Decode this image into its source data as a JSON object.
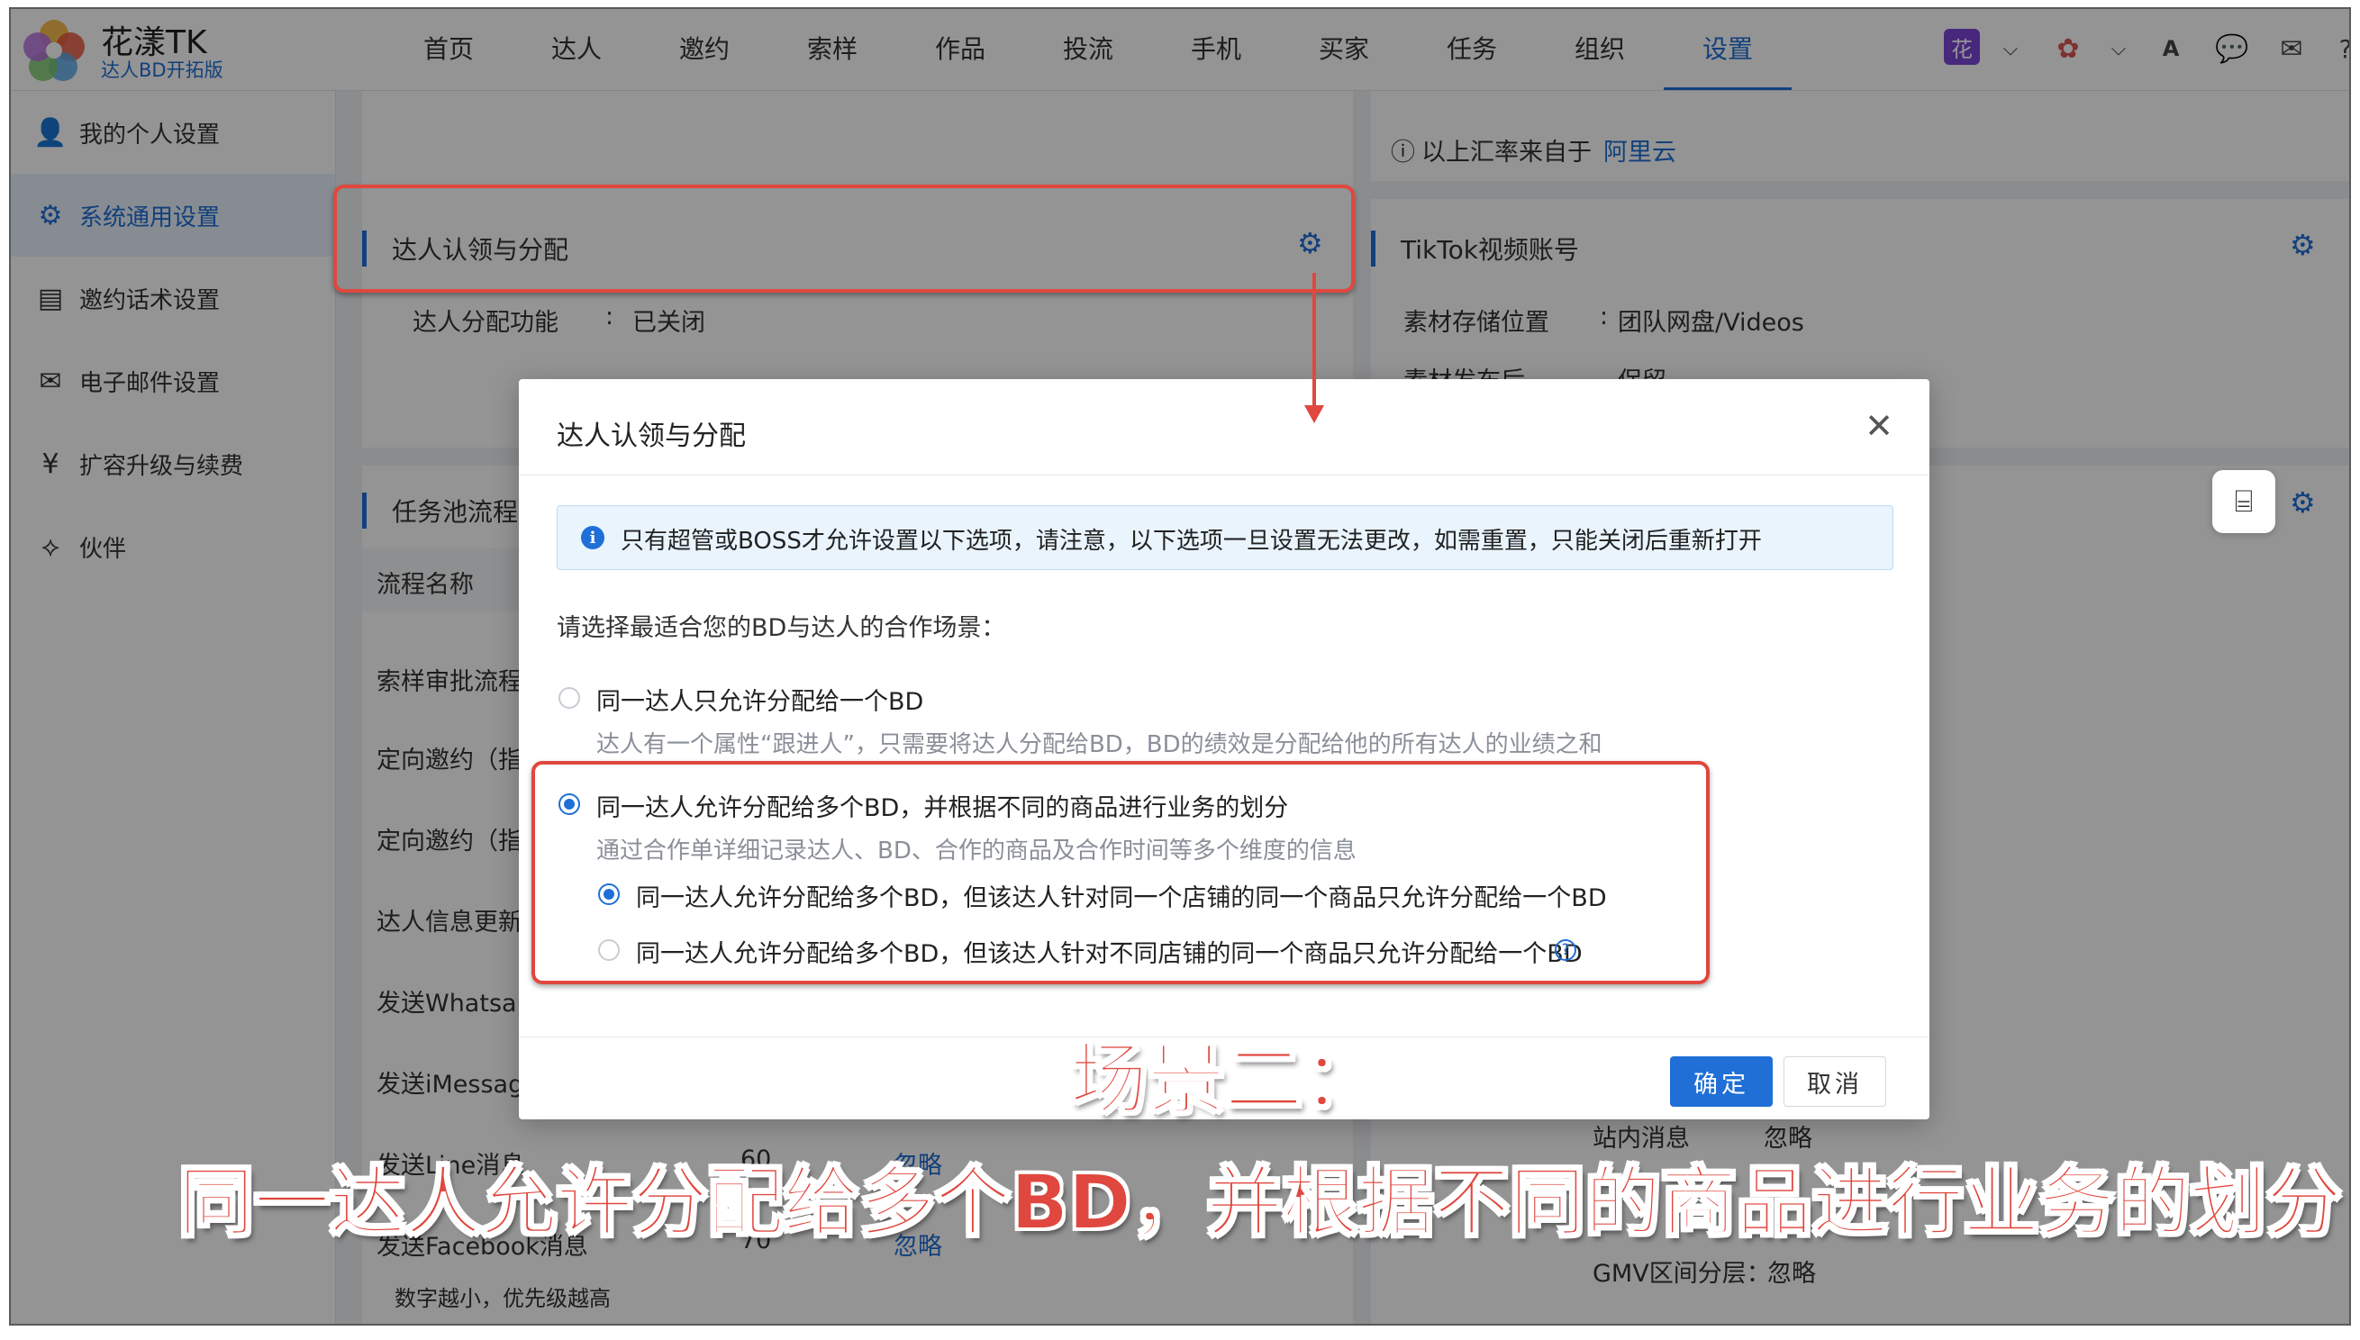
{
  "header": {
    "brand_name": "花漾TK",
    "brand_sub": "达人BD开拓版",
    "nav": [
      "首页",
      "达人",
      "邀约",
      "索样",
      "作品",
      "投流",
      "手机",
      "买家",
      "任务",
      "组织",
      "设置"
    ],
    "nav_active": "设置",
    "avatar_text": "花",
    "translate_glyph": "A"
  },
  "sidebar": {
    "items": [
      {
        "label": "我的个人设置",
        "icon": "user-icon",
        "glyph": "👤"
      },
      {
        "label": "系统通用设置",
        "icon": "gear-icon",
        "glyph": "⚙"
      },
      {
        "label": "邀约话术设置",
        "icon": "document-icon",
        "glyph": "▤"
      },
      {
        "label": "电子邮件设置",
        "icon": "mail-icon",
        "glyph": "✉"
      },
      {
        "label": "扩容升级与续费",
        "icon": "yen-icon",
        "glyph": "¥"
      },
      {
        "label": "伙伴",
        "icon": "handshake-icon",
        "glyph": "⟡"
      }
    ]
  },
  "bg": {
    "exchange_note": "以上汇率来自于",
    "exchange_link": "阿里云",
    "claim_card_title": "达人认领与分配",
    "claim_label": "达人分配功能",
    "claim_value": "已关闭",
    "tiktok_title": "TikTok视频账号",
    "storage_label": "素材存储位置",
    "storage_value": "团队网盘/Videos",
    "publish_label": "素材发布后",
    "publish_value": "保留",
    "task_title": "任务池流程",
    "table_header": "流程名称",
    "rows": [
      "索样审批流程",
      "定向邀约（指",
      "定向邀约（指",
      "达人信息更新",
      "发送Whatsap",
      "发送iMessage",
      "发送Line消息",
      "发送Facebook消息"
    ],
    "row_values": [
      "忽略",
      "忽略"
    ],
    "row_nums": [
      "60",
      "70"
    ],
    "footer_note": "数字越小，优先级越高",
    "site_msg_label": "站内消息",
    "site_msg_value": "忽略",
    "gmv_label": "GMV区间分层：",
    "gmv_value": "忽略"
  },
  "modal": {
    "title": "达人认领与分配",
    "notice": "只有超管或BOSS才允许设置以下选项，请注意，以下选项一旦设置无法更改，如需重置，只能关闭后重新打开",
    "prompt": "请选择最适合您的BD与达人的合作场景：",
    "option1": "同一达人只允许分配给一个BD",
    "option1_desc": "达人有一个属性“跟进人”，只需要将达人分配给BD，BD的绩效是分配给他的所有达人的业绩之和",
    "option2": "同一达人允许分配给多个BD，并根据不同的商品进行业务的划分",
    "option2_desc": "通过合作单详细记录达人、BD、合作的商品及合作时间等多个维度的信息",
    "sub1": "同一达人允许分配给多个BD，但该达人针对同一个店铺的同一个商品只允许分配给一个BD",
    "sub2": "同一达人允许分配给多个BD，但该达人针对不同店铺的同一个商品只允许分配给一个BD",
    "selected_option": "option2",
    "selected_sub": "sub1",
    "ok": "确定",
    "cancel": "取消"
  },
  "annotation": {
    "caption1": "场景二：",
    "caption2": "同一达人允许分配给多个BD，并根据不同的商品进行业务的划分"
  },
  "colors": {
    "accent": "#1f6fd6",
    "annotation": "#e0473e"
  }
}
